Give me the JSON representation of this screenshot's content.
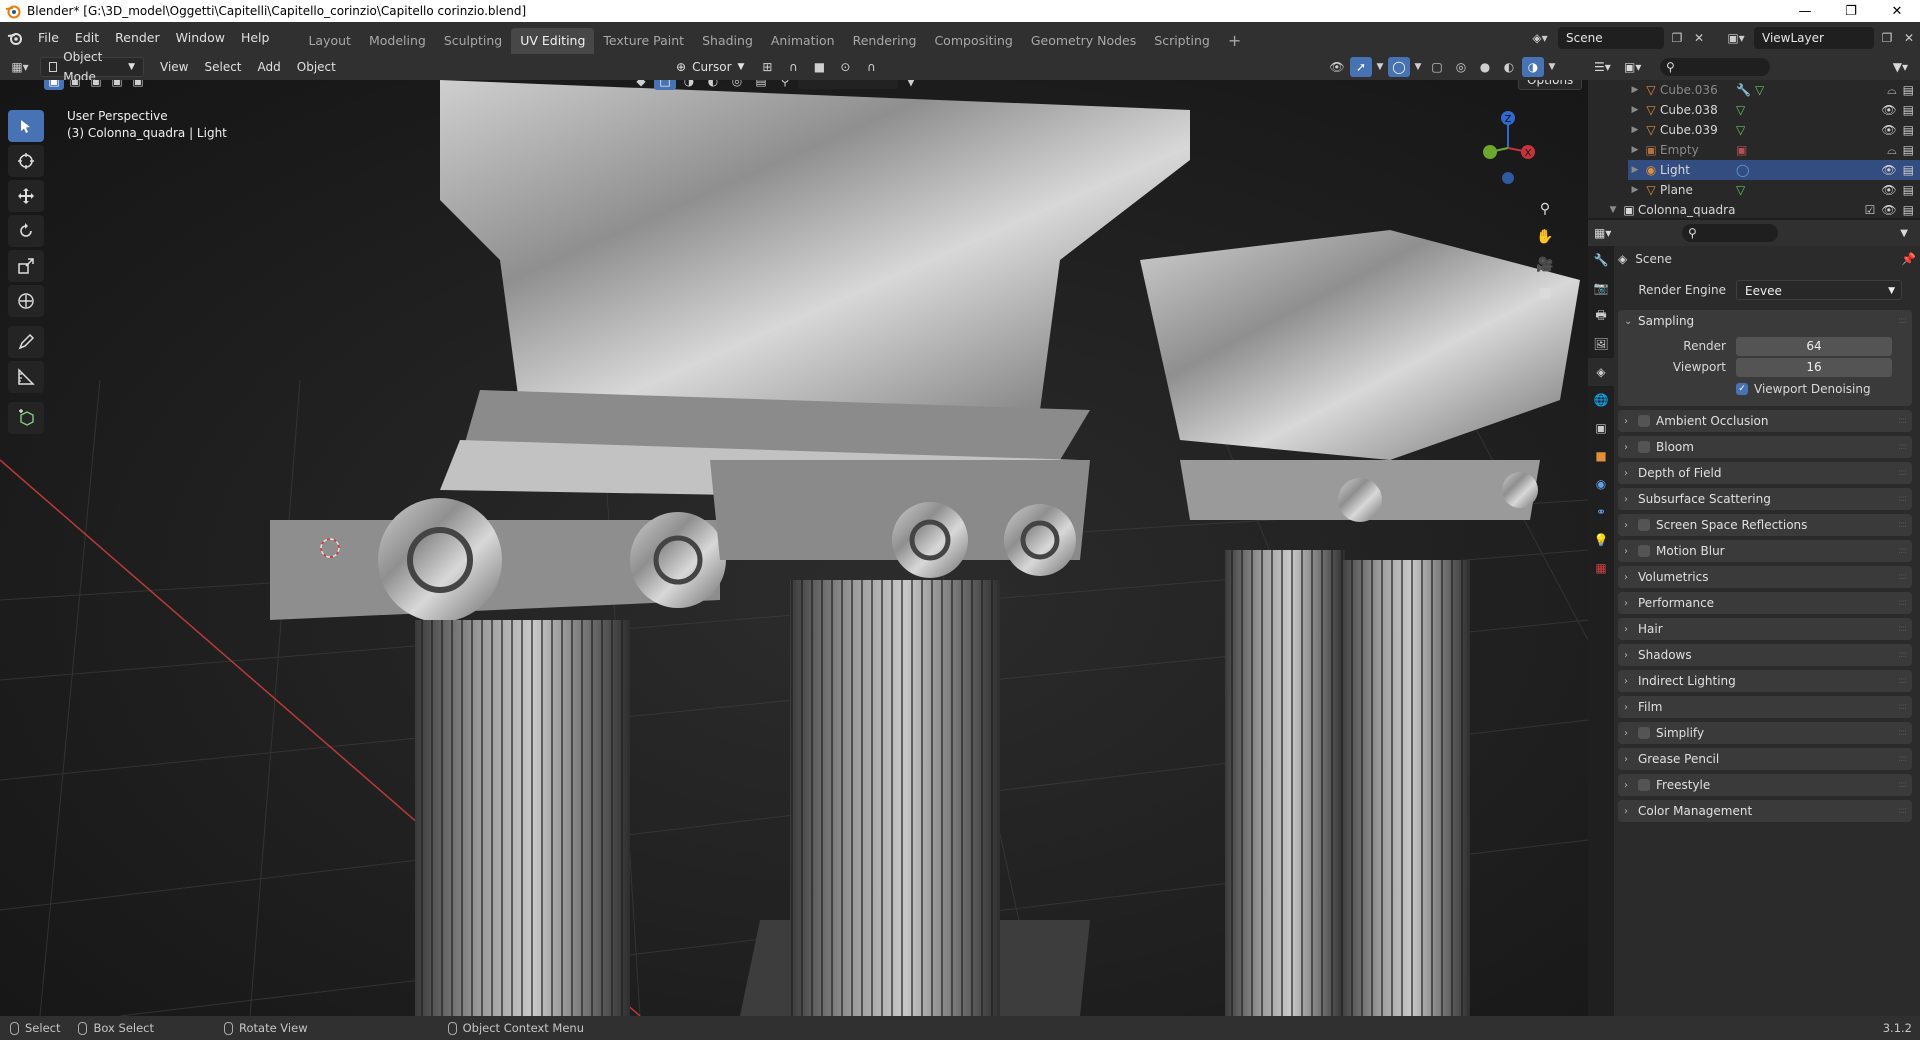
{
  "window": {
    "title": "Blender* [G:\\3D_model\\Oggetti\\Capitelli\\Capitello_corinzio\\Capitello corinzio.blend]",
    "controls": [
      "minimize",
      "maximize",
      "close"
    ]
  },
  "menu": [
    "File",
    "Edit",
    "Render",
    "Window",
    "Help"
  ],
  "workspaces": [
    "Layout",
    "Modeling",
    "Sculpting",
    "UV Editing",
    "Texture Paint",
    "Shading",
    "Animation",
    "Rendering",
    "Compositing",
    "Geometry Nodes",
    "Scripting"
  ],
  "active_workspace": "UV Editing",
  "add_workspace": "+",
  "scene": "Scene",
  "view_layer": "ViewLayer",
  "viewport_header": {
    "mode": "Object Mode",
    "menus": [
      "View",
      "Select",
      "Add",
      "Object"
    ],
    "pivot": "Cursor",
    "options": "Options"
  },
  "viewport": {
    "perspective": "User Perspective",
    "object_info": "(3) Colonna_quadra | Light",
    "gizmo_axes": {
      "z": "Z",
      "x": "X"
    },
    "colors": {
      "x_axis": "#c8323c",
      "y_axis": "#6ca82e",
      "z_axis": "#2f6ad0"
    }
  },
  "outliner": {
    "items": [
      {
        "name": "Cube.036",
        "type": "mesh",
        "dim": true
      },
      {
        "name": "Cube.038",
        "type": "mesh",
        "dim": false
      },
      {
        "name": "Cube.039",
        "type": "mesh",
        "dim": false
      },
      {
        "name": "Empty",
        "type": "empty",
        "dim": true
      },
      {
        "name": "Light",
        "type": "light",
        "selected": true
      },
      {
        "name": "Plane",
        "type": "mesh",
        "dim": false
      }
    ],
    "collection": "Colonna_quadra"
  },
  "properties": {
    "context": "Scene",
    "render_engine_label": "Render Engine",
    "render_engine": "Eevee",
    "sampling": {
      "title": "Sampling",
      "render_label": "Render",
      "render": "64",
      "viewport_label": "Viewport",
      "viewport": "16",
      "denoise_label": "Viewport Denoising",
      "denoise": true
    },
    "panels": [
      {
        "title": "Ambient Occlusion",
        "checkbox": true
      },
      {
        "title": "Bloom",
        "checkbox": true
      },
      {
        "title": "Depth of Field",
        "checkbox": false
      },
      {
        "title": "Subsurface Scattering",
        "checkbox": false
      },
      {
        "title": "Screen Space Reflections",
        "checkbox": true
      },
      {
        "title": "Motion Blur",
        "checkbox": true
      },
      {
        "title": "Volumetrics",
        "checkbox": false
      },
      {
        "title": "Performance",
        "checkbox": false
      },
      {
        "title": "Hair",
        "checkbox": false
      },
      {
        "title": "Shadows",
        "checkbox": false
      },
      {
        "title": "Indirect Lighting",
        "checkbox": false
      },
      {
        "title": "Film",
        "checkbox": false
      },
      {
        "title": "Simplify",
        "checkbox": true
      },
      {
        "title": "Grease Pencil",
        "checkbox": false
      },
      {
        "title": "Freestyle",
        "checkbox": true
      },
      {
        "title": "Color Management",
        "checkbox": false
      }
    ]
  },
  "statusbar": {
    "items": [
      "Select",
      "Box Select",
      "Rotate View",
      "Object Context Menu"
    ],
    "version": "3.1.2"
  }
}
